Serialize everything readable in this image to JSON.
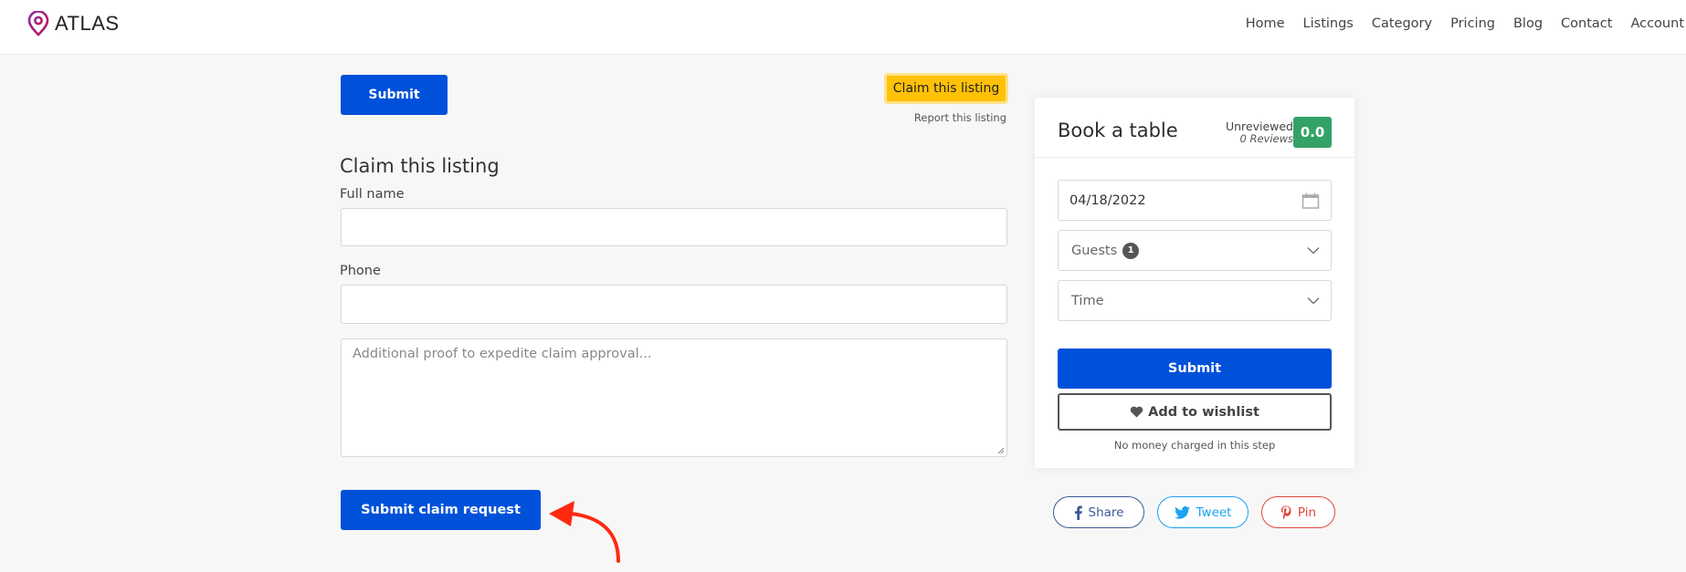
{
  "header": {
    "brand": "ATLAS",
    "brand_color": "#a4207a",
    "nav": [
      "Home",
      "Listings",
      "Category",
      "Pricing",
      "Blog",
      "Contact",
      "Account"
    ]
  },
  "main": {
    "top_submit_label": "Submit",
    "claim_button_label": "Claim this listing",
    "report_link": "Report this listing",
    "claim_form": {
      "title": "Claim this listing",
      "full_name_label": "Full name",
      "full_name_value": "",
      "phone_label": "Phone",
      "phone_value": "",
      "proof_placeholder": "Additional proof to expedite claim approval...",
      "submit_label": "Submit claim request"
    }
  },
  "booking": {
    "title": "Book a table",
    "review_status": "Unreviewed",
    "review_count": "0 Reviews",
    "score": "0.0",
    "score_color": "#34a266",
    "date_value": "04/18/2022",
    "guests_label": "Guests",
    "guests_count": "1",
    "time_label": "Time",
    "submit_label": "Submit",
    "wishlist_label": "Add to wishlist",
    "note": "No money charged in this step"
  },
  "share": {
    "facebook": "Share",
    "twitter": "Tweet",
    "pinterest": "Pin"
  },
  "colors": {
    "primary": "#0051d9",
    "claim_yellow": "#ffc107",
    "annotation_arrow": "#ff2a10"
  }
}
